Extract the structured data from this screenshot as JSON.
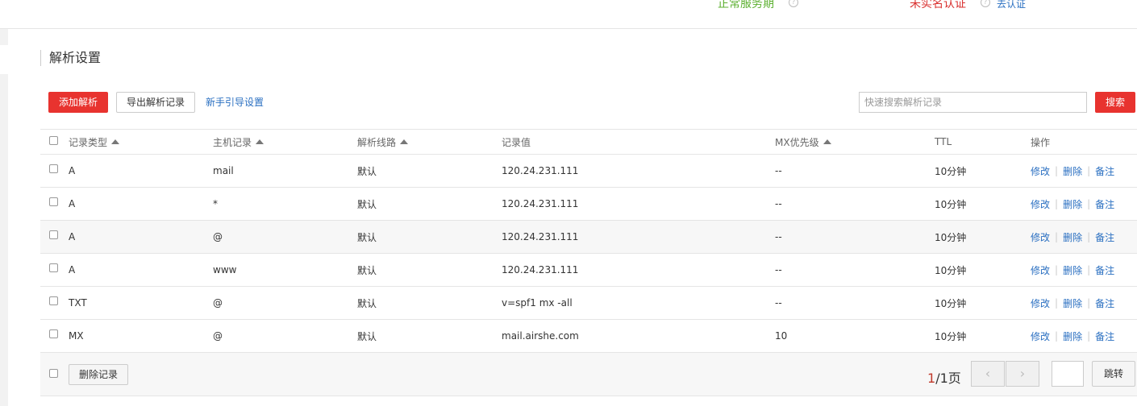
{
  "top": {
    "service_status": "正常服务期",
    "realname_status": "未实名认证",
    "cert_link": "去认证",
    "help_icon": "question-circle-icon"
  },
  "section": {
    "title": "解析设置"
  },
  "toolbar": {
    "add_label": "添加解析",
    "export_label": "导出解析记录",
    "guide_label": "新手引导设置",
    "search_placeholder": "快速搜索解析记录",
    "search_label": "搜索"
  },
  "table": {
    "headers": {
      "type": "记录类型",
      "host": "主机记录",
      "line": "解析线路",
      "value": "记录值",
      "mx": "MX优先级",
      "ttl": "TTL",
      "ops": "操作"
    },
    "ops": {
      "edit": "修改",
      "delete": "删除",
      "note": "备注"
    },
    "rows": [
      {
        "type": "A",
        "host": "mail",
        "line": "默认",
        "value": "120.24.231.111",
        "mx": "--",
        "ttl": "10分钟"
      },
      {
        "type": "A",
        "host": "*",
        "line": "默认",
        "value": "120.24.231.111",
        "mx": "--",
        "ttl": "10分钟"
      },
      {
        "type": "A",
        "host": "@",
        "line": "默认",
        "value": "120.24.231.111",
        "mx": "--",
        "ttl": "10分钟"
      },
      {
        "type": "A",
        "host": "www",
        "line": "默认",
        "value": "120.24.231.111",
        "mx": "--",
        "ttl": "10分钟"
      },
      {
        "type": "TXT",
        "host": "@",
        "line": "默认",
        "value": "v=spf1 mx -all",
        "mx": "--",
        "ttl": "10分钟"
      },
      {
        "type": "MX",
        "host": "@",
        "line": "默认",
        "value": "mail.airshe.com",
        "mx": "10",
        "ttl": "10分钟"
      }
    ]
  },
  "footer": {
    "delete_label": "删除记录",
    "page_current": "1",
    "page_total_text": "/1页",
    "prev_glyph": "‹",
    "next_glyph": "›",
    "jump_label": "跳转"
  },
  "colors": {
    "accent_red": "#e8332f",
    "link_blue": "#2a6fc1",
    "status_green": "#5cb030"
  }
}
